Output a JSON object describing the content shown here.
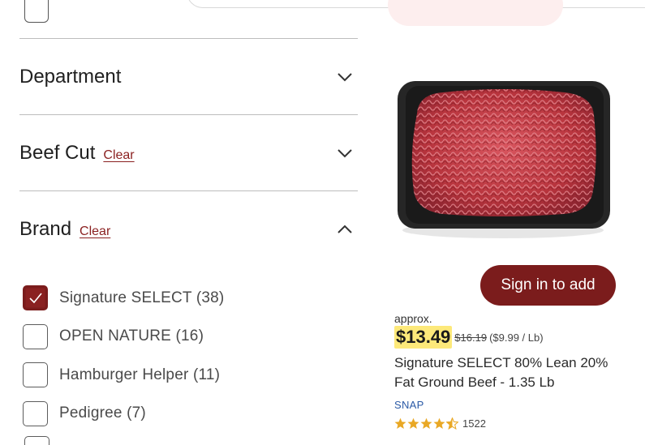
{
  "filters": {
    "department": {
      "title": "Department"
    },
    "beef_cut": {
      "title": "Beef Cut",
      "clear_label": "Clear"
    },
    "brand": {
      "title": "Brand",
      "clear_label": "Clear",
      "options": [
        {
          "label": "Signature SELECT (38)",
          "checked": true
        },
        {
          "label": "OPEN NATURE (16)",
          "checked": false
        },
        {
          "label": "Hamburger Helper (11)",
          "checked": false
        },
        {
          "label": "Pedigree (7)",
          "checked": false
        }
      ]
    }
  },
  "product": {
    "add_button_label": "Sign in to add",
    "approx_label": "approx.",
    "price": "$13.49",
    "was_price": "$16.19",
    "unit_price": "($9.99 / Lb)",
    "name": "Signature SELECT 80% Lean 20% Fat Ground Beef - 1.35 Lb",
    "snap_label": "SNAP",
    "rating": 4.5,
    "review_count": "1522"
  },
  "colors": {
    "brand_accent": "#7b1c1c",
    "price_highlight": "#fde97a",
    "star": "#e9a825",
    "snap_blue": "#2b5aa6"
  },
  "icons": {
    "collapsed": "chevron-down-icon",
    "expanded": "chevron-up-icon",
    "checkmark": "checkmark-icon",
    "star": "star-icon"
  }
}
